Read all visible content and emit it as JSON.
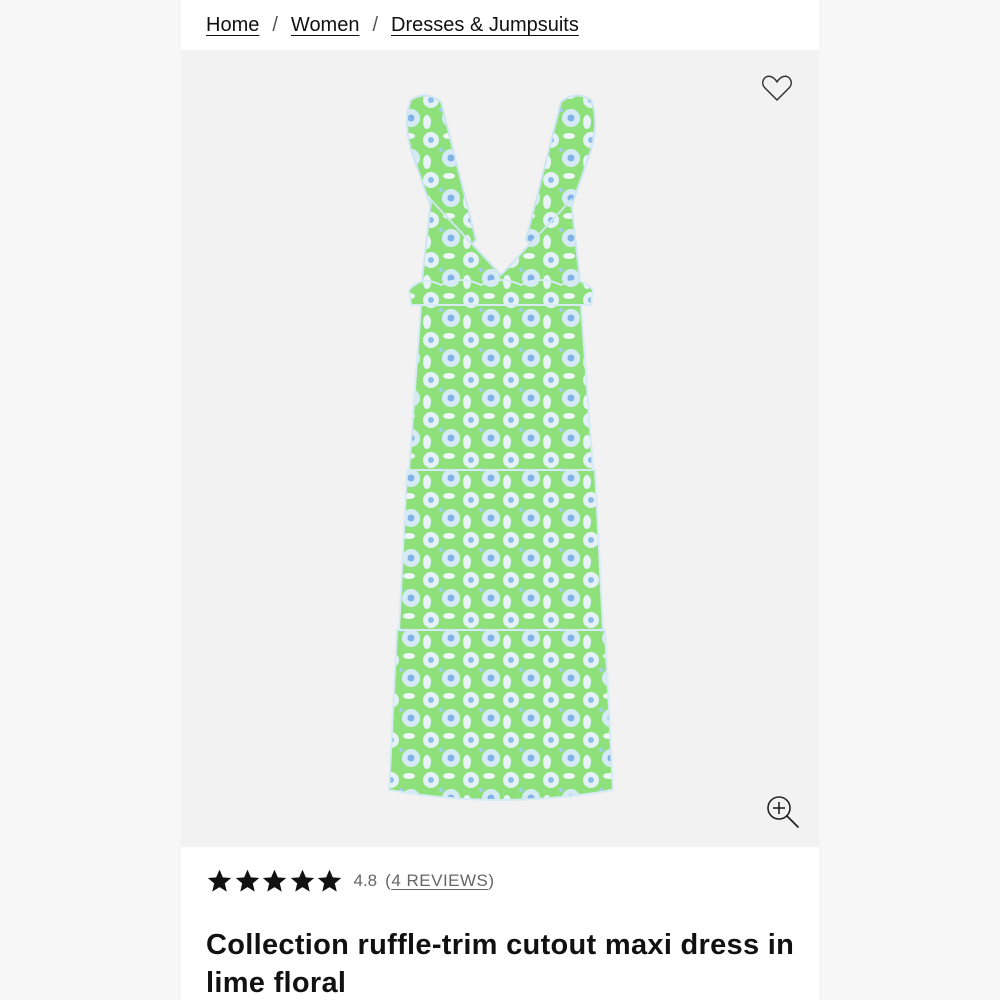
{
  "breadcrumb": {
    "items": [
      "Home",
      "Women",
      "Dresses & Jumpsuits"
    ],
    "separator": "/"
  },
  "gallery": {
    "favorite_icon": "heart-outline-icon",
    "zoom_icon": "zoom-in-icon",
    "background": "#f2f2f2",
    "product_colors": {
      "base": "#8ee07a",
      "print": "#d8ecf5",
      "accent": "#7fb2e6"
    }
  },
  "rating": {
    "stars": 5,
    "value": "4.8",
    "reviews_open": "(",
    "reviews_label": "4 REVIEWS",
    "reviews_close": ")"
  },
  "product": {
    "title": "Collection ruffle-trim cutout maxi dress in lime floral"
  }
}
